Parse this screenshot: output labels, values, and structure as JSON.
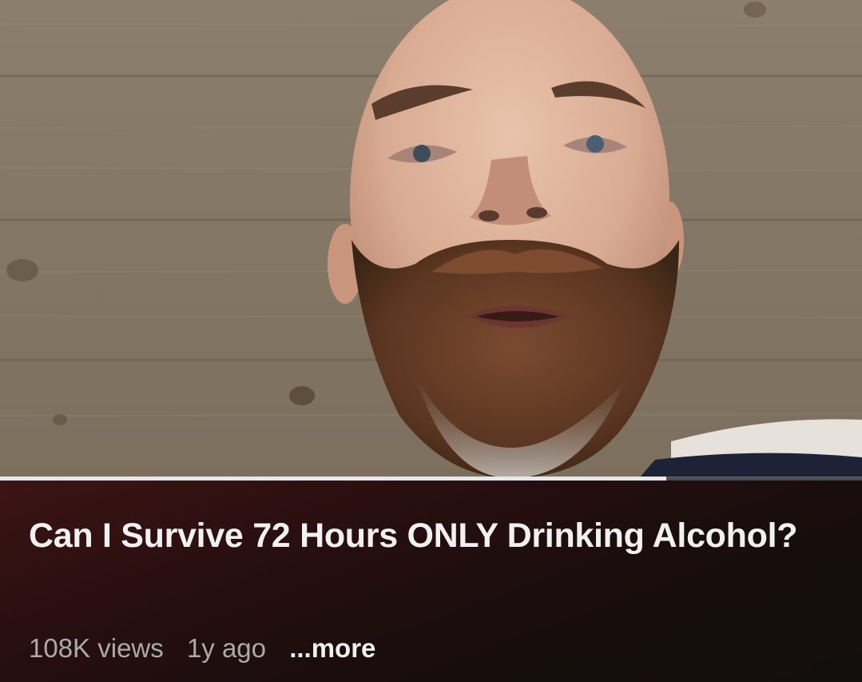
{
  "video": {
    "title": "Can I Survive 72 Hours ONLY Drinking Alcohol?",
    "views": "108K views",
    "age": "1y ago",
    "more_label": "...more",
    "progress_fraction": 0.773
  },
  "colors": {
    "panel_accent": "#3c1414",
    "title_text": "#f1f1f1",
    "meta_text": "#aaaaaa",
    "progress_played": "#e8e8e8"
  }
}
